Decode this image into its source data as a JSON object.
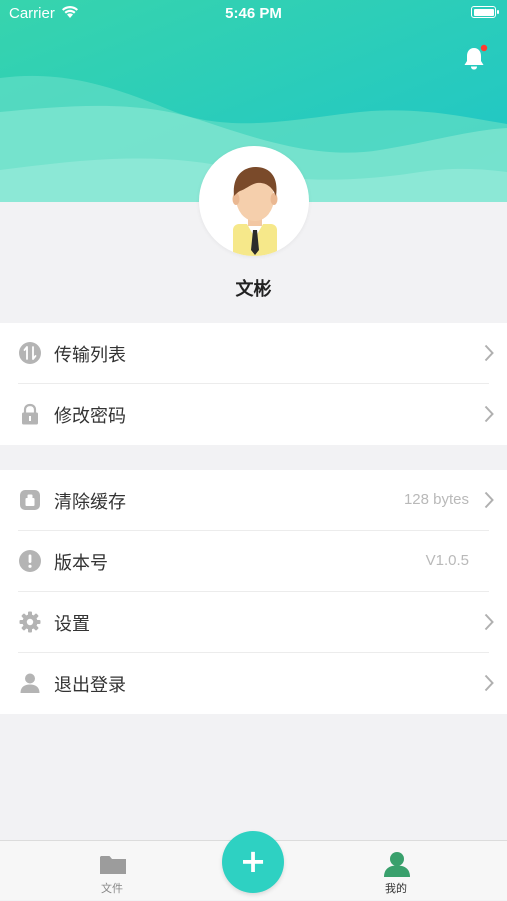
{
  "status_bar": {
    "carrier": "Carrier",
    "time": "5:46 PM"
  },
  "header": {
    "notification_icon": "bell-icon",
    "has_unread_dot": true
  },
  "profile": {
    "name": "文彬",
    "avatar_icon": "user-avatar"
  },
  "menu_group_1": [
    {
      "label": "传输列表",
      "icon": "transfer-icon",
      "value": "",
      "chevron": true
    },
    {
      "label": "修改密码",
      "icon": "lock-icon",
      "value": "",
      "chevron": true
    }
  ],
  "menu_group_2": [
    {
      "label": "清除缓存",
      "icon": "cache-icon",
      "value": "128 bytes",
      "chevron": true
    },
    {
      "label": "版本号",
      "icon": "info-icon",
      "value": "V1.0.5",
      "chevron": false
    },
    {
      "label": "设置",
      "icon": "gear-icon",
      "value": "",
      "chevron": true
    },
    {
      "label": "退出登录",
      "icon": "person-icon",
      "value": "",
      "chevron": true
    }
  ],
  "tabbar": {
    "files_label": "文件",
    "add_symbol": "+",
    "mine_label": "我的",
    "active_tab": "我的"
  },
  "colors": {
    "accent": "#2ed1c2",
    "header_gradient_start": "#3bd7b0",
    "header_gradient_end": "#22c4c6"
  }
}
